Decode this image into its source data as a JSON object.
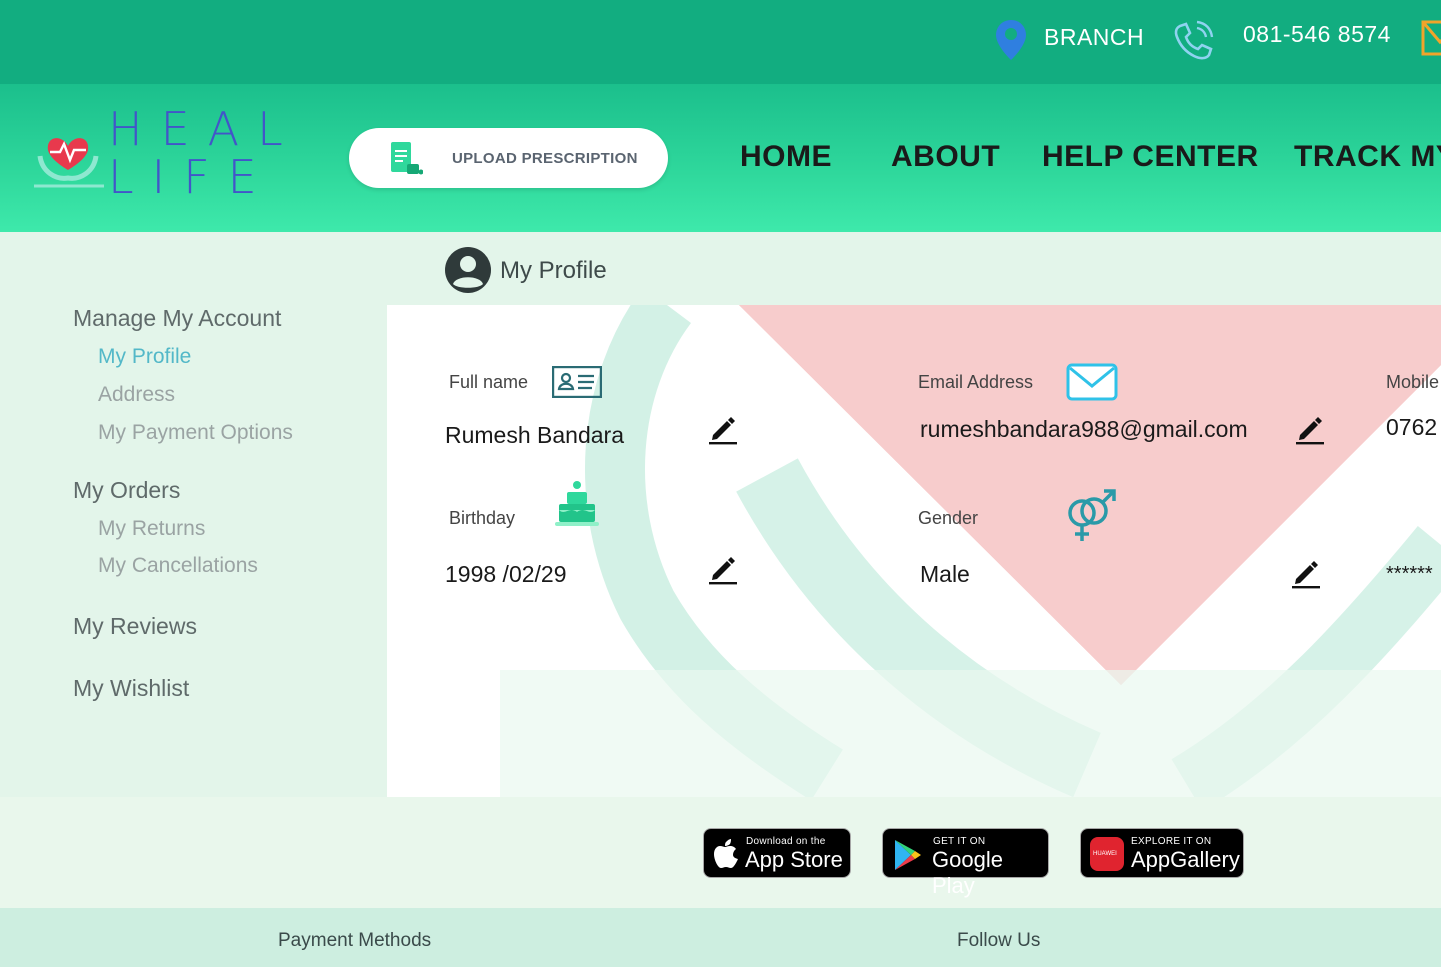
{
  "topbar": {
    "branch_label": "BRANCH",
    "phone_label": "081-546 8574"
  },
  "header": {
    "logo_line1": "HEAL",
    "logo_line2": "LIFE",
    "upload_label": "UPLOAD PRESCRIPTION",
    "nav": [
      "HOME",
      "ABOUT",
      "HELP CENTER",
      "TRACK MY"
    ]
  },
  "sidebar": {
    "manage_account": "Manage My Account",
    "my_profile": "My Profile",
    "address": "Address",
    "payment_options": "My Payment Options",
    "my_orders": "My Orders",
    "my_returns": "My Returns",
    "my_cancellations": "My Cancellations",
    "my_reviews": "My Reviews",
    "my_wishlist": "My Wishlist"
  },
  "profile": {
    "title": "My Profile",
    "full_name_label": "Full name",
    "full_name": "Rumesh Bandara",
    "email_label": "Email Address",
    "email": "rumeshbandara988@gmail.com",
    "mobile_label": "Mobile",
    "mobile": "0762",
    "birthday_label": "Birthday",
    "birthday": "1998 /02/29",
    "gender_label": "Gender",
    "gender": "Male",
    "password_masked": "******"
  },
  "apps": {
    "appstore_small": "Download on the",
    "appstore_big": "App Store",
    "googleplay_small": "GET IT ON",
    "googleplay_big": "Google Play",
    "appgallery_small": "EXPLORE IT ON",
    "appgallery_big": "AppGallery",
    "huawei_text": "HUAWEI"
  },
  "footer": {
    "payment_methods": "Payment Methods",
    "follow_us": "Follow Us"
  },
  "colors": {
    "topbar": "#12ad80",
    "accent_blue": "#4255c9",
    "active_link": "#53b8c8"
  }
}
